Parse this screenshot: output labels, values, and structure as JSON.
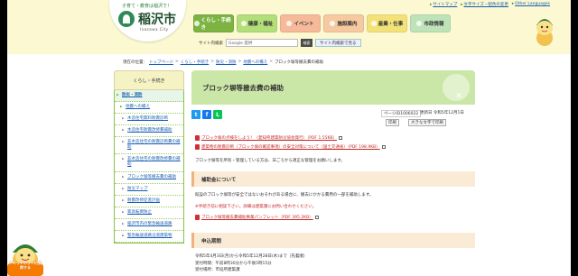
{
  "colors": {
    "header_bg": "#fbf8d2",
    "accent_green": "#7cb342",
    "title_bg": "#cbe7a8",
    "section_bg": "#faebd7",
    "link": "#1a5fb4",
    "pdf_red": "#c62828"
  },
  "header": {
    "tagline": "子育て・教育は稲沢で！",
    "logo_name": "稲沢市",
    "logo_sub": "Inazawa City",
    "top_links": [
      "サイトマップ",
      "文字サイズ・配色の変更",
      "Other Languages"
    ],
    "nav": [
      {
        "label": "くらし・手続き",
        "color": "#7cb342",
        "active": true
      },
      {
        "label": "健康・福祉",
        "color": "#b3df7a",
        "active": false
      },
      {
        "label": "イベント",
        "color": "#f6b99a",
        "active": false
      },
      {
        "label": "施設案内",
        "color": "#f6c9a0",
        "active": false
      },
      {
        "label": "産業・仕事",
        "color": "#f3e27a",
        "active": false
      },
      {
        "label": "市政情報",
        "color": "#bfe3b8",
        "active": false
      }
    ],
    "search": {
      "label": "サイト内検索",
      "placeholder": "Google 提供",
      "button": "検索",
      "list_button": "サイト内検索で見る"
    }
  },
  "breadcrumb": {
    "prefix": "現在の位置：",
    "items": [
      "トップページ",
      "くらし・手続き",
      "防災・消防",
      "地震への備え",
      "ブロック塀等撤去費の補助"
    ]
  },
  "sidebar": {
    "heading": "くらし・手続き",
    "items": [
      {
        "label": "防災・消防",
        "level": 0
      },
      {
        "label": "地震への備え",
        "level": 1
      },
      {
        "label": "木造住宅無料耐震診断",
        "level": 2
      },
      {
        "label": "木造住宅耐震改修費補助",
        "level": 2
      },
      {
        "label": "非木造住宅の耐震診断費の補助",
        "level": 2
      },
      {
        "label": "非木造住宅の耐震改修費の補助",
        "level": 2
      },
      {
        "label": "ブロック塀等撤去費の補助",
        "level": 2
      },
      {
        "label": "防災マップ",
        "level": 2
      },
      {
        "label": "耐震改修促進計画",
        "level": 2
      },
      {
        "label": "家具転倒防止",
        "level": 2
      },
      {
        "label": "稲沢市内の緊急輸送道路",
        "level": 2
      },
      {
        "label": "緊急輸送道路沿道建築物",
        "level": 2
      }
    ]
  },
  "main": {
    "title": "ブロック塀等撤去費の補助",
    "share": [
      "t",
      "f",
      "L"
    ],
    "page_id": "ページID1006022",
    "updated": "更新日 令和5年12月1日",
    "print": "印刷",
    "large_text": "大きな文字で印刷",
    "pdf_links": [
      "ブロック塀の点検をしよう！（愛知県建築防災協会発行）（PDF 1.55KB）",
      "建築物の耐震診断（ブロック塀の確認事項）の安全対策について（国土交通省）（PDF 198.9KB）"
    ],
    "intro": "ブロック塀等を所有・管理している方は、日ごろから適正な管理をお願いします。",
    "sections": [
      {
        "heading": "補助金について",
        "body": "既設のブロック塀等が安全ではないおそれがある場合に、撤去にかかる費用の一部を補助します。",
        "note": "※手続き前に相談下さい。詳細は建築課にお問い合わせください。",
        "pdf": "ブロック塀等撤去費補助事業パンフレット（PDF 395.2KB）"
      },
      {
        "heading": "申込期間",
        "body": "令和5年4月3日(月)から令和5年12月28日(木)まで（先着順）"
      }
    ],
    "footer_lines": [
      "受付時間：午前8時30分から午後5時15分",
      "受付場所：市役所建築課"
    ]
  },
  "mascot": {
    "text": "チャットボットに質問する"
  }
}
